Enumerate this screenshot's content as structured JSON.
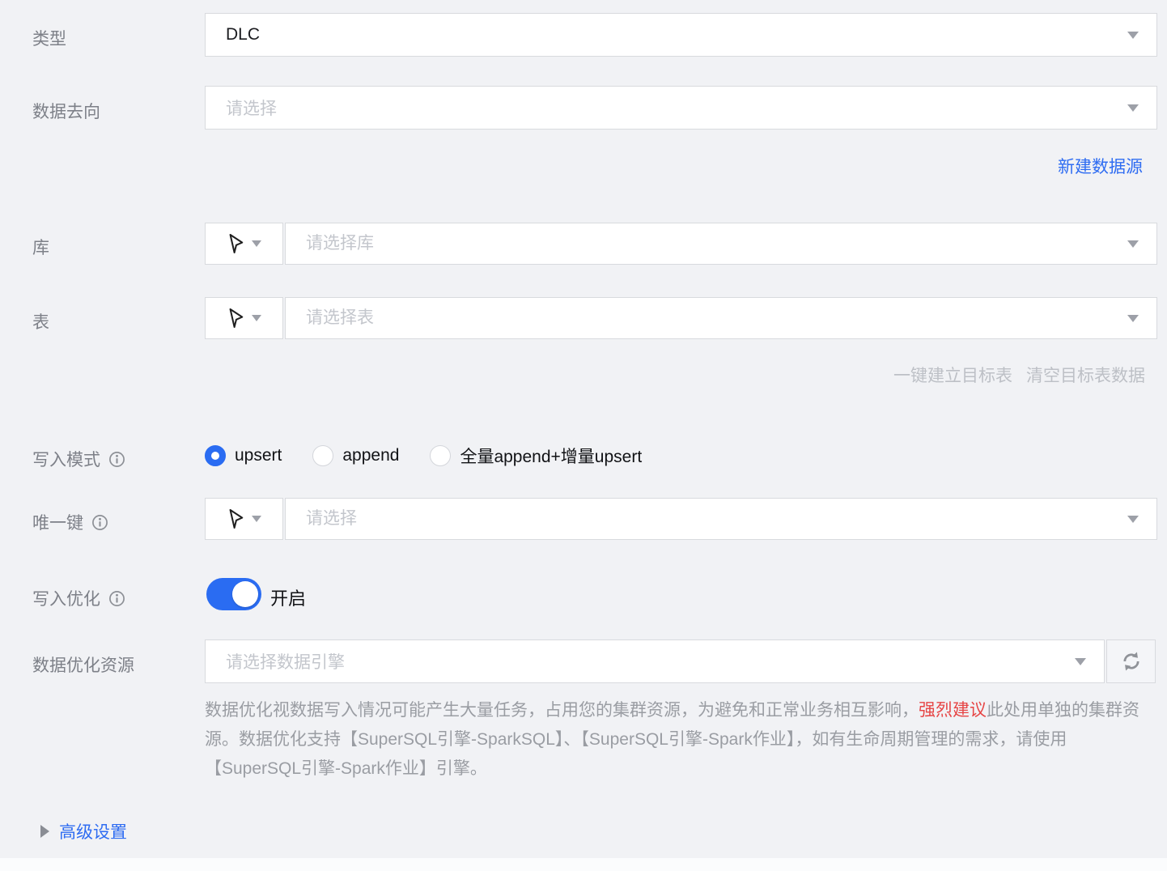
{
  "colors": {
    "accent_blue": "#2a6cf2",
    "danger_red": "#e64545",
    "background": "#f1f2f5"
  },
  "icons": {
    "cursor_select": "cursor-arrow glyph in field prefix box",
    "caret_down": "gray triangle dropdown caret",
    "info": "circled letter i",
    "refresh": "two circular sync arrows",
    "collapsed_arrow": "right-pointing triangle"
  },
  "form": {
    "type": {
      "label": "类型",
      "value": "DLC"
    },
    "destination": {
      "label": "数据去向",
      "placeholder": "请选择"
    },
    "create_datasource_link": "新建数据源",
    "database": {
      "label": "库",
      "placeholder": "请选择库"
    },
    "table": {
      "label": "表",
      "placeholder": "请选择表"
    },
    "table_actions": {
      "create_target_table": "一键建立目标表",
      "clear_target_table": "清空目标表数据"
    },
    "write_mode": {
      "label": "写入模式",
      "options": [
        {
          "label": "upsert",
          "selected": true
        },
        {
          "label": "append",
          "selected": false
        },
        {
          "label": "全量append+增量upsert",
          "selected": false
        }
      ]
    },
    "unique_key": {
      "label": "唯一键",
      "placeholder": "请选择"
    },
    "write_optimization": {
      "label": "写入优化",
      "state": "开启",
      "enabled": true
    },
    "optimization_resource": {
      "label": "数据优化资源",
      "placeholder": "请选择数据引擎",
      "help_before": "数据优化视数据写入情况可能产生大量任务，占用您的集群资源，为避免和正常业务相互影响，",
      "help_emphasis": "强烈建议",
      "help_after": "此处用单独的集群资源。数据优化支持【SuperSQL引擎-SparkSQL】、【SuperSQL引擎-Spark作业】，如有生命周期管理的需求，请使用【SuperSQL引擎-Spark作业】引擎。"
    },
    "advanced_settings": "高级设置"
  }
}
